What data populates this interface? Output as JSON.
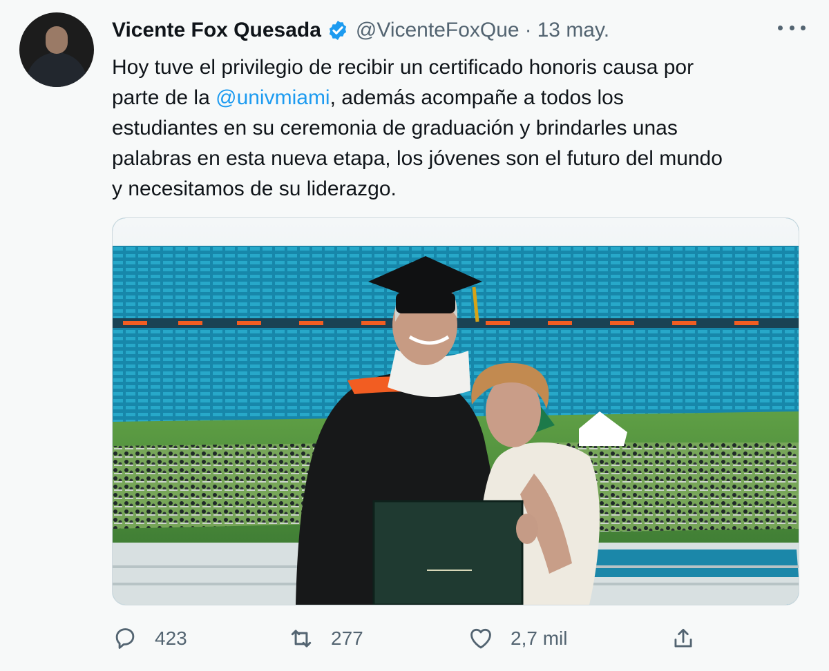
{
  "tweet": {
    "author_name": "Vicente Fox Quesada",
    "author_handle": "@VicenteFoxQue",
    "date": "13 may.",
    "text_before_mention": "Hoy tuve el privilegio de recibir un certificado honoris causa por\nparte de la ",
    "mention": "@univmiami",
    "text_after_mention": ", además acompañe a todos los\nestudiantes en su ceremonia de graduación y brindarles unas\npalabras en esta nueva etapa, los jóvenes son el futuro del mundo\ny necesitamos de su liderazgo.",
    "reply_count": "423",
    "retweet_count": "277",
    "like_count": "2,7 mil"
  },
  "icons": {
    "verified": "verified-badge-icon",
    "more": "more-options-icon",
    "reply": "reply-icon",
    "retweet": "retweet-icon",
    "like": "heart-icon",
    "share": "share-icon"
  },
  "colors": {
    "accent": "#1d9bf0",
    "secondary_text": "#536471",
    "background": "#f7f9f9"
  }
}
